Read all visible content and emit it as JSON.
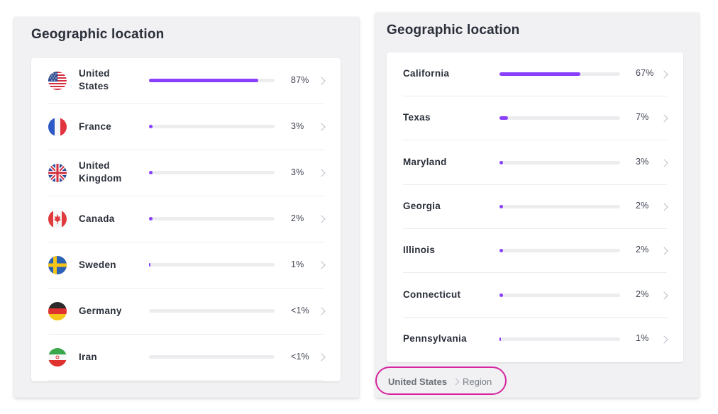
{
  "left_panel": {
    "title": "Geographic location",
    "rows": [
      {
        "name_line1": "United",
        "name_line2": "States",
        "percent_label": "87%",
        "fill_fraction": 0.87,
        "flag_icon": "us-flag-icon"
      },
      {
        "name_line1": "France",
        "name_line2": "",
        "percent_label": "3%",
        "fill_fraction": 0.03,
        "flag_icon": "france-flag-icon"
      },
      {
        "name_line1": "United",
        "name_line2": "Kingdom",
        "percent_label": "3%",
        "fill_fraction": 0.03,
        "flag_icon": "uk-flag-icon"
      },
      {
        "name_line1": "Canada",
        "name_line2": "",
        "percent_label": "2%",
        "fill_fraction": 0.02,
        "flag_icon": "canada-flag-icon"
      },
      {
        "name_line1": "Sweden",
        "name_line2": "",
        "percent_label": "1%",
        "fill_fraction": 0.01,
        "flag_icon": "sweden-flag-icon"
      },
      {
        "name_line1": "Germany",
        "name_line2": "",
        "percent_label": "<1%",
        "fill_fraction": 0.0,
        "flag_icon": "germany-flag-icon"
      },
      {
        "name_line1": "Iran",
        "name_line2": "",
        "percent_label": "<1%",
        "fill_fraction": 0.0,
        "flag_icon": "iran-flag-icon"
      }
    ]
  },
  "right_panel": {
    "title": "Geographic location",
    "rows": [
      {
        "name": "California",
        "percent_label": "67%",
        "fill_fraction": 0.67
      },
      {
        "name": "Texas",
        "percent_label": "7%",
        "fill_fraction": 0.07
      },
      {
        "name": "Maryland",
        "percent_label": "3%",
        "fill_fraction": 0.03
      },
      {
        "name": "Georgia",
        "percent_label": "2%",
        "fill_fraction": 0.02
      },
      {
        "name": "Illinois",
        "percent_label": "2%",
        "fill_fraction": 0.02
      },
      {
        "name": "Connecticut",
        "percent_label": "2%",
        "fill_fraction": 0.02
      },
      {
        "name": "Pennsylvania",
        "percent_label": "1%",
        "fill_fraction": 0.01
      }
    ],
    "breadcrumb": {
      "first": "United States",
      "second": "Region"
    }
  },
  "colors": {
    "accent": "#8a3ffc",
    "highlight": "#d6249f"
  }
}
